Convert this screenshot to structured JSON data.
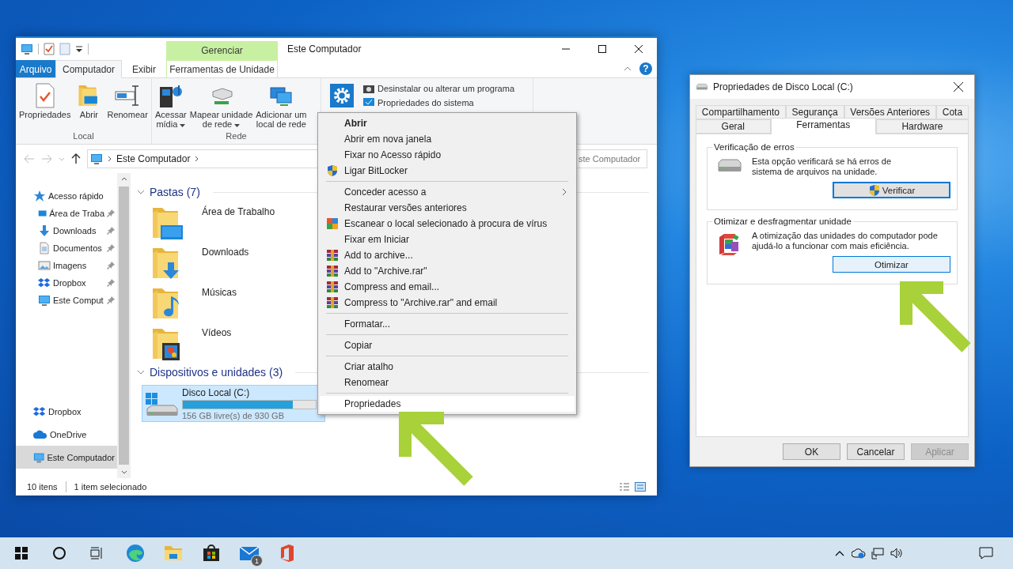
{
  "explorer": {
    "title": "Este Computador",
    "context_header": "Gerenciar",
    "help": "?",
    "ribbon_tabs": [
      {
        "label": "Arquivo",
        "kind": "file",
        "selected": false
      },
      {
        "label": "Computador",
        "kind": "tab",
        "selected": true
      },
      {
        "label": "Exibir",
        "kind": "tab",
        "selected": false
      },
      {
        "label": "Ferramentas de Unidade",
        "kind": "context",
        "selected": false
      }
    ],
    "ribbon_groups": [
      {
        "kind": "large",
        "label": "Local",
        "buttons": [
          {
            "lines": [
              "Propriedades"
            ],
            "dropdown": false
          },
          {
            "lines": [
              "Abrir"
            ],
            "dropdown": false
          },
          {
            "lines": [
              "Renomear"
            ],
            "dropdown": false
          }
        ]
      },
      {
        "kind": "large",
        "label": "Rede",
        "buttons": [
          {
            "lines": [
              "Acessar",
              "mídia"
            ],
            "dropdown": true
          },
          {
            "lines": [
              "Mapear unidade",
              "de rede"
            ],
            "dropdown": true
          },
          {
            "lines": [
              "Adicionar um",
              "local de rede"
            ],
            "dropdown": false
          }
        ]
      },
      {
        "kind": "system",
        "small_items": [
          "Desinstalar ou alterar um programa",
          "Propriedades do sistema"
        ]
      }
    ],
    "address": {
      "crumbs": [
        "Este Computador"
      ]
    },
    "search_placeholder": "ste Computador",
    "nav_pane": {
      "quick_access": {
        "label": "Acesso rápido",
        "selected": false,
        "children": [
          {
            "label": "Área de Traba",
            "pinned": true,
            "selected": false
          },
          {
            "label": "Downloads",
            "pinned": true,
            "selected": false
          },
          {
            "label": "Documentos",
            "pinned": true,
            "selected": false
          },
          {
            "label": "Imagens",
            "pinned": true,
            "selected": false
          },
          {
            "label": "Dropbox",
            "pinned": true,
            "selected": false
          },
          {
            "label": "Este Comput",
            "pinned": true,
            "selected": false
          }
        ]
      },
      "items": [
        {
          "label": "Dropbox",
          "selected": false
        },
        {
          "label": "OneDrive",
          "selected": false
        },
        {
          "label": "Este Computador",
          "selected": true
        }
      ]
    },
    "sections": [
      {
        "title": "Pastas (7)",
        "expanded": true,
        "folders": [
          "Área de Trabalho",
          "Downloads",
          "Músicas",
          "Vídeos"
        ]
      },
      {
        "title": "Dispositivos e unidades (3)",
        "expanded": true,
        "drives": [
          {
            "name": "Disco Local (C:)",
            "level": 0.83,
            "free": "156 GB livre(s) de 930 GB",
            "selected": true
          }
        ]
      }
    ],
    "status": {
      "count": "10 itens",
      "selection": "1 item selecionado"
    }
  },
  "context_menu": {
    "items": [
      {
        "kind": "item",
        "label": "Abrir",
        "default": true,
        "submenu": false,
        "selected": false
      },
      {
        "kind": "item",
        "label": "Abrir em nova janela",
        "default": false,
        "submenu": false,
        "selected": false
      },
      {
        "kind": "item",
        "label": "Fixar no Acesso rápido",
        "default": false,
        "submenu": false,
        "selected": false
      },
      {
        "kind": "shield",
        "label": "Ligar BitLocker",
        "default": false,
        "submenu": false,
        "selected": false
      },
      {
        "kind": "separator"
      },
      {
        "kind": "item",
        "label": "Conceder acesso a",
        "default": false,
        "submenu": true,
        "selected": false
      },
      {
        "kind": "item",
        "label": "Restaurar versões anteriores",
        "default": false,
        "submenu": false,
        "selected": false
      },
      {
        "kind": "scan",
        "label": "Escanear o local selecionado à procura de vírus",
        "default": false,
        "submenu": false,
        "selected": false
      },
      {
        "kind": "item",
        "label": "Fixar em Iniciar",
        "default": false,
        "submenu": false,
        "selected": false
      },
      {
        "kind": "archive",
        "label": "Add to archive...",
        "default": false,
        "submenu": false,
        "selected": false
      },
      {
        "kind": "archive",
        "label": "Add to \"Archive.rar\"",
        "default": false,
        "submenu": false,
        "selected": false
      },
      {
        "kind": "archive",
        "label": "Compress and email...",
        "default": false,
        "submenu": false,
        "selected": false
      },
      {
        "kind": "archive",
        "label": "Compress to \"Archive.rar\" and email",
        "default": false,
        "submenu": false,
        "selected": false
      },
      {
        "kind": "separator"
      },
      {
        "kind": "item",
        "label": "Formatar...",
        "default": false,
        "submenu": false,
        "selected": false
      },
      {
        "kind": "separator"
      },
      {
        "kind": "item",
        "label": "Copiar",
        "default": false,
        "submenu": false,
        "selected": false
      },
      {
        "kind": "separator"
      },
      {
        "kind": "item",
        "label": "Criar atalho",
        "default": false,
        "submenu": false,
        "selected": false
      },
      {
        "kind": "item",
        "label": "Renomear",
        "default": false,
        "submenu": false,
        "selected": false
      },
      {
        "kind": "separator"
      },
      {
        "kind": "item",
        "label": "Propriedades",
        "default": false,
        "submenu": false,
        "selected": true
      }
    ]
  },
  "dialog": {
    "title": "Propriedades de Disco Local (C:)",
    "tab_rows": [
      [
        {
          "label": "Compartilhamento",
          "selected": false
        },
        {
          "label": "Segurança",
          "selected": false
        },
        {
          "label": "Versões Anteriores",
          "selected": false
        },
        {
          "label": "Cota",
          "selected": false
        }
      ],
      [
        {
          "label": "Geral",
          "selected": false
        },
        {
          "label": "Ferramentas",
          "selected": true
        },
        {
          "label": "Hardware",
          "selected": false
        }
      ]
    ],
    "groups": [
      {
        "title": "Verificação de erros",
        "text_lines": [
          "Esta opção verificará se há erros de",
          "sistema de arquivos na unidade."
        ],
        "button": "Verificar",
        "elevated": true,
        "focused": true,
        "hovered": false
      },
      {
        "title": "Otimizar e desfragmentar unidade",
        "text_lines": [
          "A otimização das unidades do computador pode",
          "ajudá-lo a funcionar com mais eficiência."
        ],
        "button": "Otimizar",
        "elevated": false,
        "focused": false,
        "hovered": true
      }
    ],
    "buttons": [
      {
        "label": "OK",
        "disabled": false
      },
      {
        "label": "Cancelar",
        "disabled": false
      },
      {
        "label": "Aplicar",
        "disabled": true
      }
    ]
  },
  "taskbar": {
    "mail_badge": "1"
  }
}
